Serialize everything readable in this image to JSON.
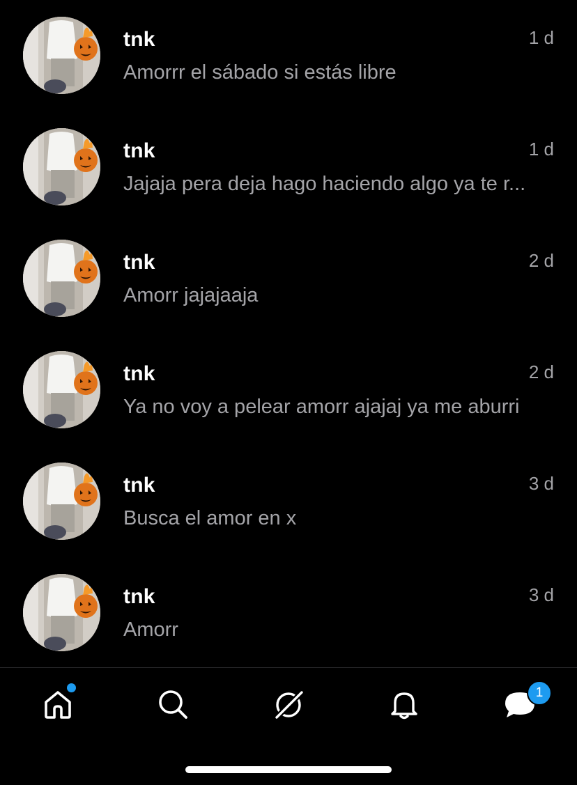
{
  "conversations": [
    {
      "name": "tnk",
      "time": "1 d",
      "preview": "Amorrr el sábado si estás libre"
    },
    {
      "name": "tnk",
      "time": "1 d",
      "preview": "Jajaja pera deja hago haciendo algo ya te r..."
    },
    {
      "name": "tnk",
      "time": "2 d",
      "preview": "Amorr jajajaaja"
    },
    {
      "name": "tnk",
      "time": "2 d",
      "preview": "Ya no voy a pelear amorr ajajaj ya me aburri"
    },
    {
      "name": "tnk",
      "time": "3 d",
      "preview": "Busca el amor en x"
    },
    {
      "name": "tnk",
      "time": "3 d",
      "preview": "Amorr"
    }
  ],
  "tab_bar": {
    "tabs": [
      {
        "id": "home",
        "icon": "home-icon",
        "has_dot": true
      },
      {
        "id": "search",
        "icon": "search-icon"
      },
      {
        "id": "grok",
        "icon": "grok-icon"
      },
      {
        "id": "notifications",
        "icon": "bell-icon"
      },
      {
        "id": "messages",
        "icon": "messages-icon",
        "badge": "1"
      }
    ],
    "accent_color": "#1d9bf0"
  },
  "colors": {
    "background": "#000000",
    "primary_text": "#ffffff",
    "secondary_text": "#a4a4a8"
  }
}
